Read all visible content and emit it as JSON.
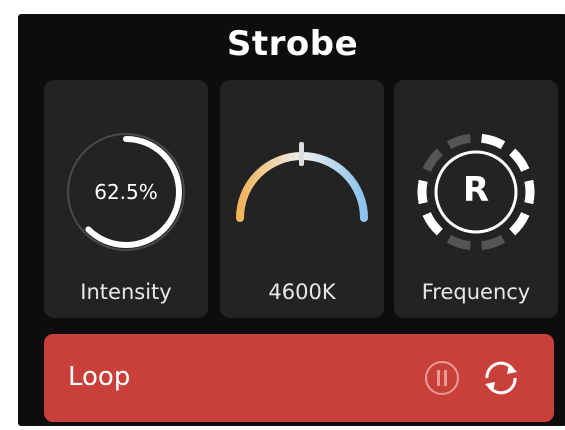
{
  "header": {
    "title": "Strobe"
  },
  "cards": {
    "intensity": {
      "value": "62.5%",
      "label": "Intensity",
      "level": 0.625
    },
    "temperature": {
      "label": "4600K",
      "level": 0.5
    },
    "frequency": {
      "letter": "R",
      "label": "Frequency"
    }
  },
  "loop": {
    "label": "Loop"
  },
  "colors": {
    "background": "#0d0d0d",
    "card": "#232323",
    "loop_bar": "#c9403b",
    "warm": "#f1b45a",
    "cool": "#8cc4ee"
  },
  "icons": [
    "pause-icon",
    "refresh-icon"
  ]
}
